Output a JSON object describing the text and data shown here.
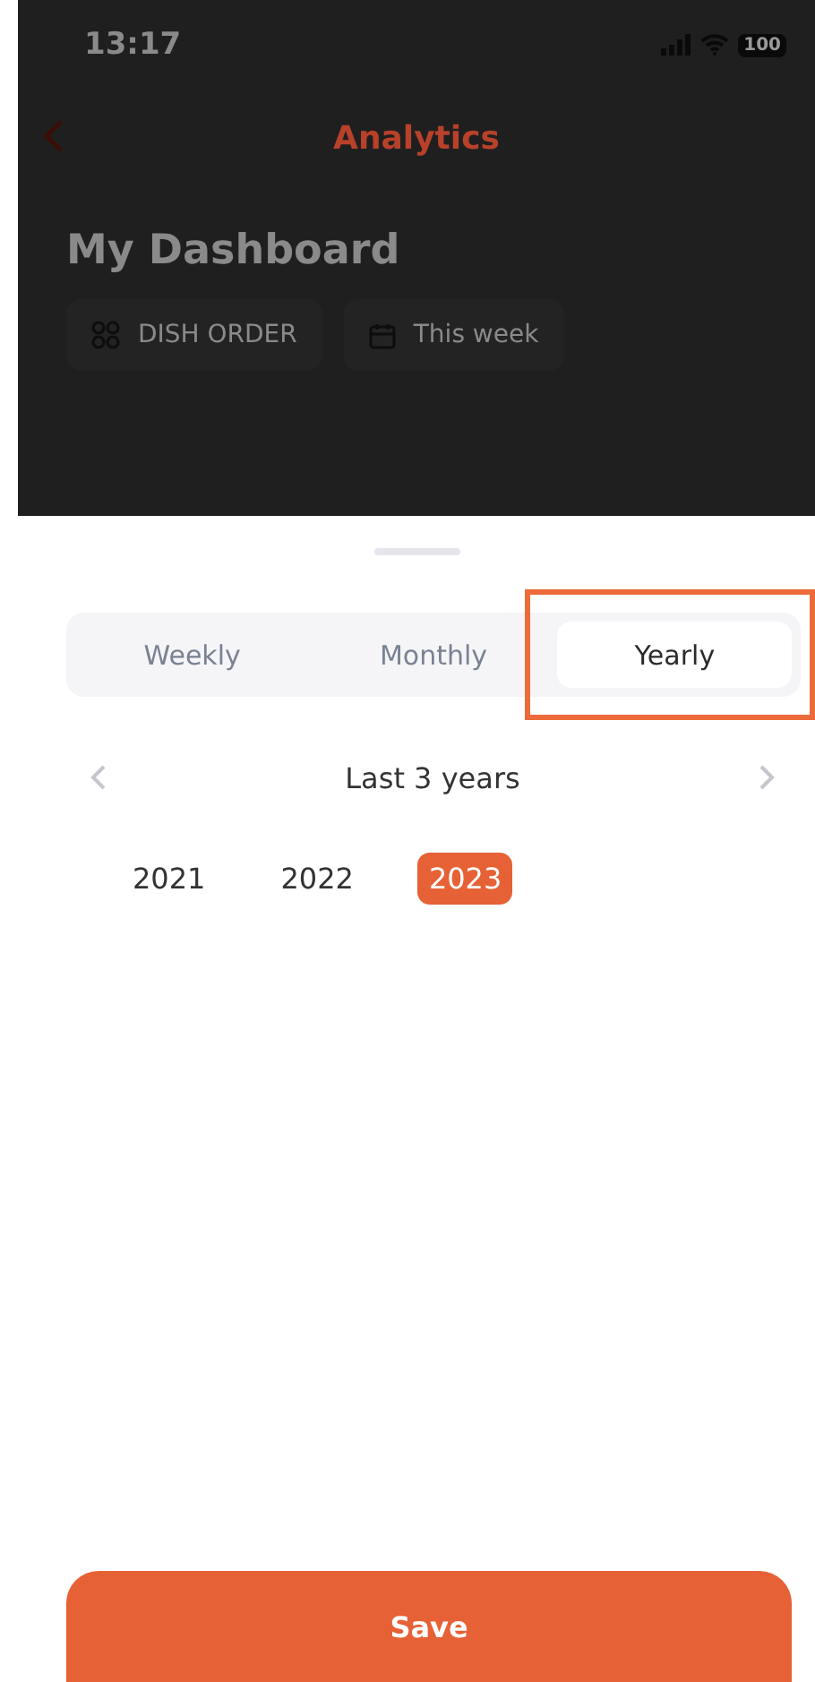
{
  "status_bar": {
    "time": "13:17",
    "battery": "100"
  },
  "header": {
    "title": "Analytics"
  },
  "dashboard": {
    "title": "My Dashboard",
    "filters": [
      {
        "kind": "category",
        "label": "DISH ORDER"
      },
      {
        "kind": "date",
        "label": "This week"
      }
    ]
  },
  "sheet": {
    "tabs": [
      {
        "label": "Weekly",
        "selected": false,
        "highlighted": false
      },
      {
        "label": "Monthly",
        "selected": false,
        "highlighted": false
      },
      {
        "label": "Yearly",
        "selected": true,
        "highlighted": true
      }
    ],
    "period": "Last 3 years",
    "years": [
      {
        "label": "2021",
        "selected": false
      },
      {
        "label": "2022",
        "selected": false
      },
      {
        "label": "2023",
        "selected": true
      }
    ],
    "save_button": "Save"
  }
}
